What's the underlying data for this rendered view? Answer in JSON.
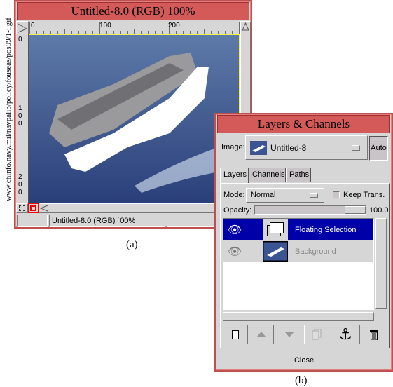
{
  "side_url": "www.chinfo.navy.mil/navpalib/policy/fouseas/pos99/1-i.gif",
  "image_window": {
    "title": "Untitled-8.0 (RGB) 100%",
    "ruler_top": [
      "0",
      "100",
      "200"
    ],
    "ruler_left": [
      "0",
      "100",
      "200"
    ],
    "status": "Untitled-8.0 (RGB) ˙00%",
    "selection_color": "#ffff00"
  },
  "captions": {
    "a": "(a)",
    "b": "(b)"
  },
  "layers_window": {
    "title": "Layers & Channels",
    "image_label": "Image:",
    "image_value": "Untitled-8",
    "auto_label": "Auto",
    "tabs": [
      {
        "label": "Layers",
        "active": true
      },
      {
        "label": "Channels"
      },
      {
        "label": "Paths"
      }
    ],
    "mode_label": "Mode:",
    "mode_value": "Normal",
    "keep_trans_label": "Keep Trans.",
    "keep_trans_checked": false,
    "opacity_label": "Opacity:",
    "opacity_value": "100.0",
    "layers": [
      {
        "name": "Floating Selection",
        "selected": true,
        "visible": true
      },
      {
        "name": "Background",
        "selected": false,
        "visible": true
      }
    ],
    "buttons": [
      "new-layer",
      "raise-layer",
      "lower-layer",
      "duplicate-layer",
      "anchor-layer",
      "delete-layer"
    ],
    "close_label": "Close",
    "selected_color": "#0000a8"
  }
}
